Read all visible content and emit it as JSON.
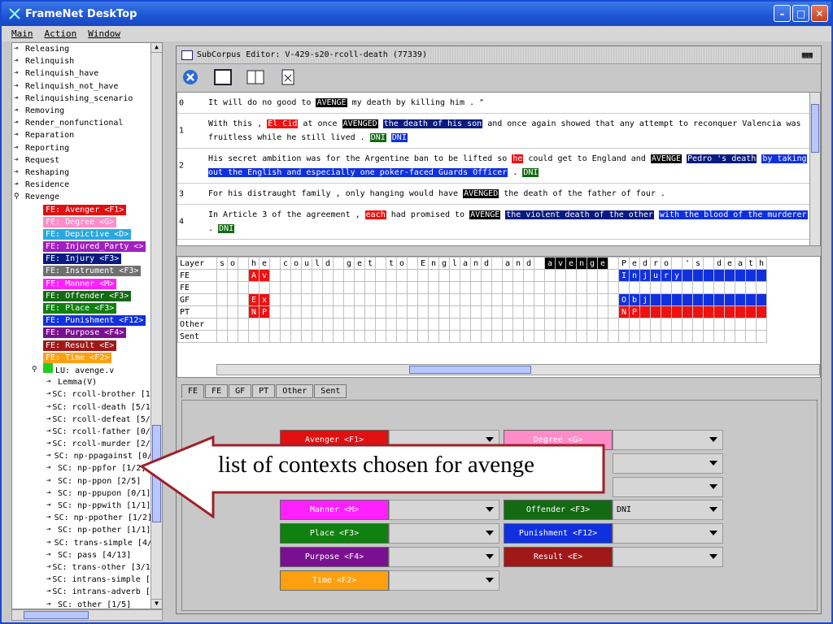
{
  "app": {
    "title": "FrameNet DeskTop"
  },
  "menu": {
    "main": "Main",
    "action": "Action",
    "window": "Window"
  },
  "tree": {
    "frames": [
      "Releasing",
      "Relinquish",
      "Relinquish_have",
      "Relinquish_not_have",
      "Relinquishing_scenario",
      "Removing",
      "Render_nonfunctional",
      "Reparation",
      "Reporting",
      "Request",
      "Reshaping",
      "Residence",
      "Revenge"
    ],
    "fes": [
      {
        "label": "FE: Avenger <F1>",
        "color": "#e01010"
      },
      {
        "label": "FE: Degree <G>",
        "color": "#ff8cc8"
      },
      {
        "label": "FE: Depictive <D>",
        "color": "#29a8e0"
      },
      {
        "label": "FE: Injured_Party <>",
        "color": "#a020c0"
      },
      {
        "label": "FE: Injury <F3>",
        "color": "#0a1a80"
      },
      {
        "label": "FE: Instrument <F3>",
        "color": "#707070"
      },
      {
        "label": "FE: Manner <M>",
        "color": "#ff20ff"
      },
      {
        "label": "FE: Offender <F3>",
        "color": "#136a13"
      },
      {
        "label": "FE: Place <F3>",
        "color": "#108010"
      },
      {
        "label": "FE: Punishment <F12>",
        "color": "#1030e0"
      },
      {
        "label": "FE: Purpose <F4>",
        "color": "#7a1090"
      },
      {
        "label": "FE: Result <E>",
        "color": "#a01818"
      },
      {
        "label": "FE: Time <F2>",
        "color": "#ffa010"
      }
    ],
    "lu": "LU: avenge.v",
    "lemma": "Lemma(V)",
    "subcorpora": [
      "SC: rcoll-brother [1/",
      "SC: rcoll-death [5/1:",
      "SC: rcoll-defeat [5/:",
      "SC: rcoll-father [0/:",
      "SC: rcoll-murder [2/:",
      "SC: np-ppagainst [0/",
      "SC: np-ppfor [1/2]",
      "SC: np-ppon [2/5]",
      "SC: np-ppupon [0/1]",
      "SC: np-ppwith [1/1]",
      "SC: np-ppother [1/2]",
      "SC: np-pother [1/1]",
      "SC: trans-simple [4/",
      "SC: pass [4/13]",
      "SC: trans-other [3/1:",
      "SC: intrans-simple [:",
      "SC: intrans-adverb [:",
      "SC: other [1/5]"
    ]
  },
  "editor": {
    "title": "SubCorpus Editor: V-429-s20-rcoll-death (77339)",
    "sentences": [
      {
        "num": "0",
        "parts": [
          [
            "It will do no good to ",
            ""
          ],
          [
            "AVENGE",
            "blk"
          ],
          [
            " my death by killing him . \"",
            ""
          ]
        ]
      },
      {
        "num": "1",
        "parts": [
          [
            "With this , ",
            ""
          ],
          [
            "El Cid",
            "red"
          ],
          [
            " at once ",
            ""
          ],
          [
            "AVENGED",
            "blk"
          ],
          [
            " ",
            ""
          ],
          [
            "the death of his son",
            "nav"
          ],
          [
            " and once again showed that any attempt to reconquer Valencia was fruitless while he still lived . ",
            ""
          ],
          [
            "DNI",
            "grn"
          ],
          [
            " ",
            ""
          ],
          [
            "DNI",
            "blu"
          ]
        ]
      },
      {
        "num": "2",
        "parts": [
          [
            "His secret ambition was for the Argentine ban to be lifted so ",
            ""
          ],
          [
            "he",
            "red"
          ],
          [
            " could get to England and ",
            ""
          ],
          [
            "AVENGE",
            "blk"
          ],
          [
            " ",
            ""
          ],
          [
            "Pedro 's death",
            "nav"
          ],
          [
            " ",
            ""
          ],
          [
            "by taking out the English and especially one poker-faced Guards Officer",
            "blu"
          ],
          [
            " . ",
            ""
          ],
          [
            "DNI",
            "grn"
          ]
        ]
      },
      {
        "num": "3",
        "parts": [
          [
            "For his distraught family , only hanging would have ",
            ""
          ],
          [
            "AVENGED",
            "blk"
          ],
          [
            " the death of the father of four .",
            ""
          ]
        ]
      },
      {
        "num": "4",
        "parts": [
          [
            "In Article 3 of the agreement , ",
            ""
          ],
          [
            "each",
            "red"
          ],
          [
            " had promised to ",
            ""
          ],
          [
            "AVENGE",
            "blk"
          ],
          [
            " ",
            ""
          ],
          [
            "the violent death of the other",
            "nav"
          ],
          [
            " ",
            ""
          ],
          [
            "with the blood of the murderer",
            "blu"
          ],
          [
            " . ",
            ""
          ],
          [
            "DNI",
            "grn"
          ]
        ]
      }
    ],
    "layer_header": "Layer",
    "layers": [
      "FE",
      "FE",
      "GF",
      "PT",
      "Other",
      "Sent"
    ],
    "chars": [
      "s",
      "o",
      " ",
      "h",
      "e",
      " ",
      "c",
      "o",
      "u",
      "l",
      "d",
      " ",
      "g",
      "e",
      "t",
      " ",
      "t",
      "o",
      " ",
      "E",
      "n",
      "g",
      "l",
      "a",
      "n",
      "d",
      " ",
      "a",
      "n",
      "d",
      " ",
      "a",
      "v",
      "e",
      "n",
      "g",
      "e",
      " ",
      "P",
      "e",
      "d",
      "r",
      "o",
      " ",
      "'",
      "s",
      " ",
      "d",
      "e",
      "a",
      "t",
      "h"
    ],
    "tabs": [
      "FE",
      "FE",
      "GF",
      "PT",
      "Other",
      "Sent"
    ],
    "fe_buttons": [
      {
        "label": "Avenger <F1>",
        "color": "#e01010",
        "value": ""
      },
      {
        "label": "Degree <G>",
        "color": "#ff8cc8",
        "value": ""
      },
      {
        "label": "Manner <M>",
        "color": "#ff20ff",
        "value": ""
      },
      {
        "label": "Offender <F3>",
        "color": "#136a13",
        "value": "DNI"
      },
      {
        "label": "Place <F3>",
        "color": "#108010",
        "value": ""
      },
      {
        "label": "Punishment <F12>",
        "color": "#1030e0",
        "value": ""
      },
      {
        "label": "Purpose <F4>",
        "color": "#7a1090",
        "value": ""
      },
      {
        "label": "Result <E>",
        "color": "#a01818",
        "value": ""
      },
      {
        "label": "Time <F2>",
        "color": "#ffa010",
        "value": ""
      }
    ]
  },
  "callout": {
    "text": "list of contexts chosen for avenge"
  }
}
